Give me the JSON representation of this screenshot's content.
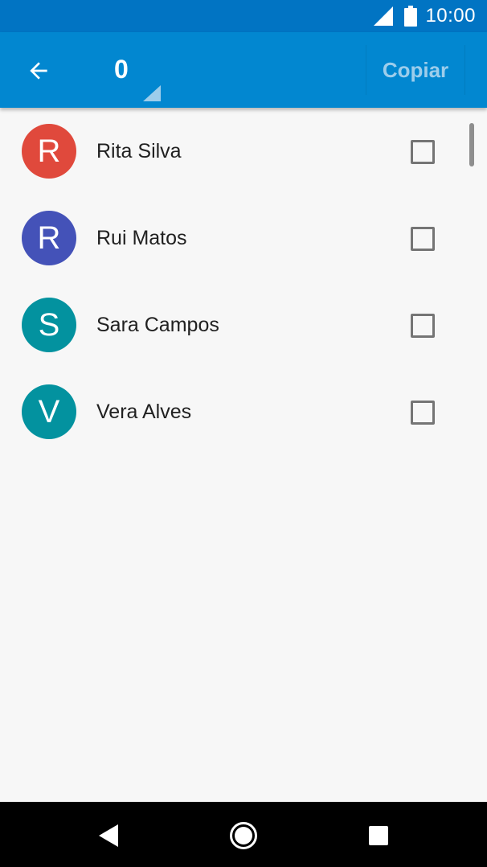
{
  "status_bar": {
    "time": "10:00",
    "icons": [
      "signal-icon",
      "battery-icon"
    ]
  },
  "toolbar": {
    "back_icon": "arrow-left-icon",
    "selected_count": "0",
    "copy_label": "Copiar",
    "background": "#0287d0",
    "status_background": "#0174c3"
  },
  "contacts": [
    {
      "initial": "R",
      "name": "Rita Silva",
      "color": "#e0493c",
      "checked": false
    },
    {
      "initial": "R",
      "name": "Rui Matos",
      "color": "#4452b8",
      "checked": false
    },
    {
      "initial": "S",
      "name": "Sara Campos",
      "color": "#03929f",
      "checked": false
    },
    {
      "initial": "V",
      "name": "Vera Alves",
      "color": "#03929f",
      "checked": false
    }
  ],
  "nav_bar": {
    "icons": [
      "back-triangle-icon",
      "home-circle-icon",
      "recents-square-icon"
    ]
  }
}
